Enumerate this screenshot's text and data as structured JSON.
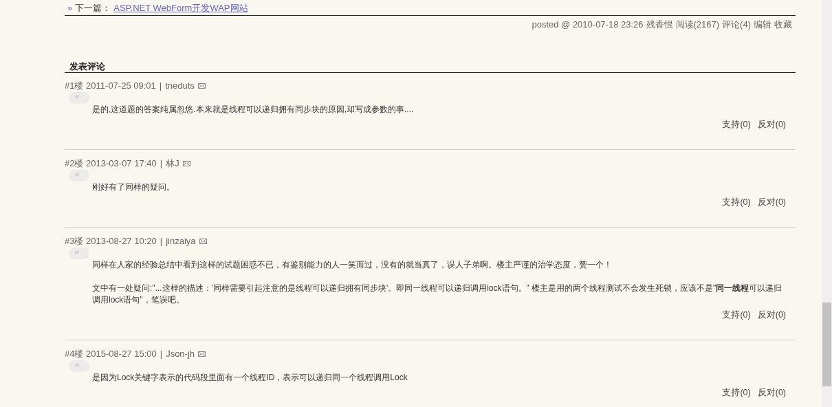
{
  "next_post": {
    "prefix": "»",
    "label": "下一篇：",
    "link": "ASP.NET WebForm开发WAP网站"
  },
  "post_meta": {
    "posted": "posted @ 2010-07-18 23:26",
    "author": "残香恨",
    "reads": "阅读(2167)",
    "comments": "评论(4)",
    "edit": "编辑",
    "favorite": "收藏"
  },
  "comment_section": {
    "title": "发表评论"
  },
  "comments": [
    {
      "floor": "#1楼",
      "date": "2011-07-25 09:01",
      "separator": "|",
      "author": "tneduts",
      "paragraphs": [
        "是的,这道题的答案纯属忽悠.本来就是线程可以递归拥有同步块的原因,却写成参数的事...."
      ],
      "support": "支持(0)",
      "oppose": "反对(0)"
    },
    {
      "floor": "#2楼",
      "date": "2013-03-07 17:40",
      "separator": "|",
      "author": "林J",
      "paragraphs": [
        "刚好有了同样的疑问。"
      ],
      "support": "支持(0)",
      "oppose": "反对(0)"
    },
    {
      "floor": "#3楼",
      "date": "2013-08-27 10:20",
      "separator": "|",
      "author": "jinzaiya",
      "paragraphs": [
        "同样在人家的经验总结中看到这样的试题困惑不已，有鉴别能力的人一笑而过，没有的就当真了，误人子弟啊。楼主严谨的治学态度，赞一个！",
        "文中有一处疑问:\"...这样的描述：'同样需要引起注意的是线程可以递归拥有同步块'。即同一线程可以递归调用lock语句。\" 楼主是用的两个线程测试不会发生死锁，应该不是\"**同一线程**可以递归调用lock语句\"，笔误吧。"
      ],
      "support": "支持(0)",
      "oppose": "反对(0)"
    },
    {
      "floor": "#4楼",
      "date": "2015-08-27 15:00",
      "separator": "|",
      "author": "Json-jh",
      "paragraphs": [
        "是因为Lock关键字表示的代码段里面有一个线程ID，表示可以递归同一个线程调用Lock"
      ],
      "support": "支持(0)",
      "oppose": "反对(0)"
    }
  ]
}
